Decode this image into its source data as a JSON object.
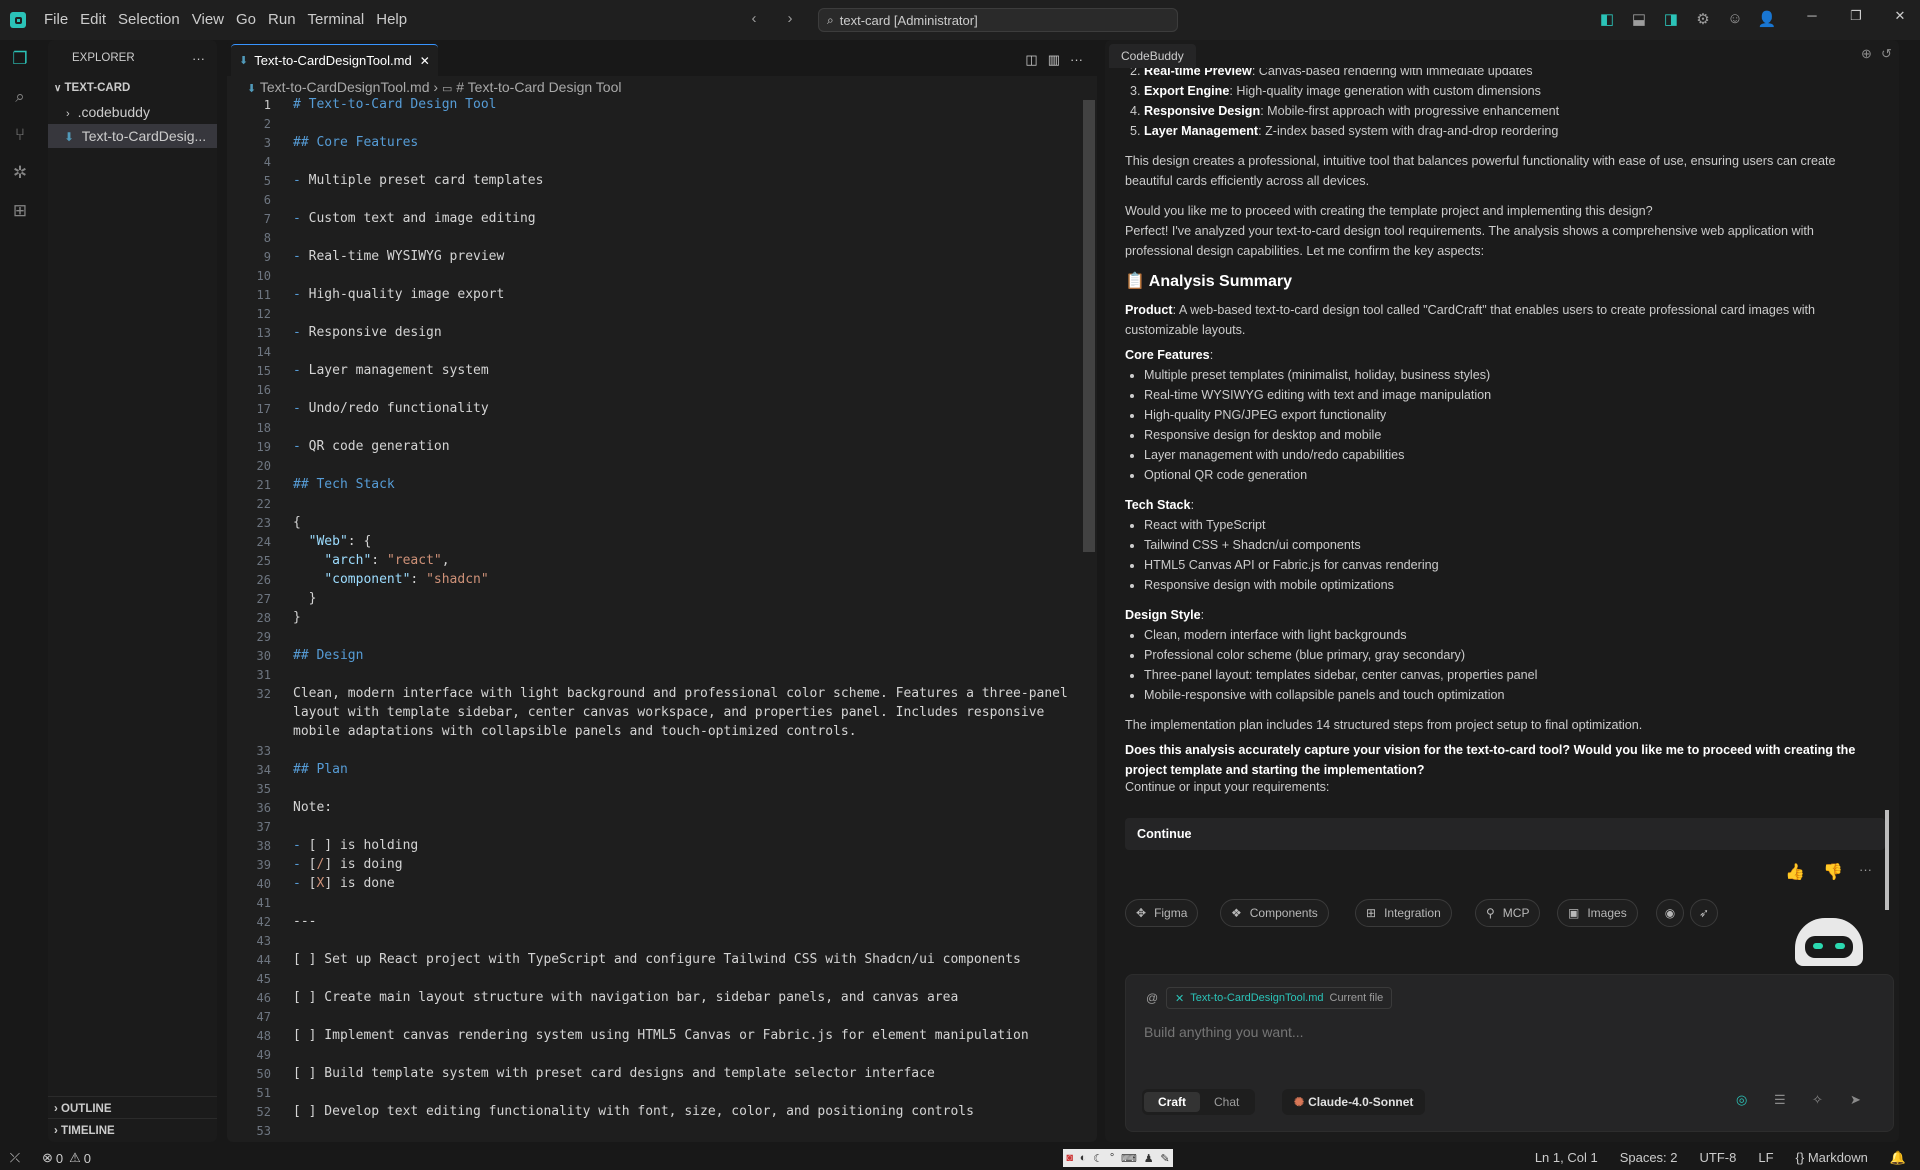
{
  "menu": [
    "File",
    "Edit",
    "Selection",
    "View",
    "Go",
    "Run",
    "Terminal",
    "Help"
  ],
  "command_center": "text-card [Administrator]",
  "explorer": {
    "title": "EXPLORER",
    "root": "TEXT-CARD",
    "items": [
      ".codebuddy",
      "Text-to-CardDesig..."
    ],
    "outline": "OUTLINE",
    "timeline": "TIMELINE"
  },
  "editor": {
    "tab": "Text-to-CardDesignTool.md",
    "breadcrumb_file": "Text-to-CardDesignTool.md",
    "breadcrumb_symbol": "# Text-to-Card Design Tool"
  },
  "code": [
    {
      "n": "1",
      "t": "# Text-to-Card Design Tool",
      "c": "h"
    },
    {
      "n": "2",
      "t": ""
    },
    {
      "n": "3",
      "t": "## Core Features",
      "c": "h"
    },
    {
      "n": "4",
      "t": ""
    },
    {
      "n": "5",
      "t": "- Multiple preset card templates"
    },
    {
      "n": "6",
      "t": ""
    },
    {
      "n": "7",
      "t": "- Custom text and image editing"
    },
    {
      "n": "8",
      "t": ""
    },
    {
      "n": "9",
      "t": "- Real-time WYSIWYG preview"
    },
    {
      "n": "10",
      "t": ""
    },
    {
      "n": "11",
      "t": "- High-quality image export"
    },
    {
      "n": "12",
      "t": ""
    },
    {
      "n": "13",
      "t": "- Responsive design"
    },
    {
      "n": "14",
      "t": ""
    },
    {
      "n": "15",
      "t": "- Layer management system"
    },
    {
      "n": "16",
      "t": ""
    },
    {
      "n": "17",
      "t": "- Undo/redo functionality"
    },
    {
      "n": "18",
      "t": ""
    },
    {
      "n": "19",
      "t": "- QR code generation"
    },
    {
      "n": "20",
      "t": ""
    },
    {
      "n": "21",
      "t": "## Tech Stack",
      "c": "h"
    },
    {
      "n": "22",
      "t": ""
    },
    {
      "n": "23",
      "t": "{"
    },
    {
      "n": "24",
      "t": "  \"Web\": {"
    },
    {
      "n": "25",
      "t": "    \"arch\": \"react\","
    },
    {
      "n": "26",
      "t": "    \"component\": \"shadcn\""
    },
    {
      "n": "27",
      "t": "  }"
    },
    {
      "n": "28",
      "t": "}"
    },
    {
      "n": "29",
      "t": ""
    },
    {
      "n": "30",
      "t": "## Design",
      "c": "h"
    },
    {
      "n": "31",
      "t": ""
    },
    {
      "n": "32",
      "t": "Clean, modern interface with light background and professional color scheme. Features a three-panel"
    },
    {
      "n": "",
      "t": "layout with template sidebar, center canvas workspace, and properties panel. Includes responsive"
    },
    {
      "n": "",
      "t": "mobile adaptations with collapsible panels and touch-optimized controls."
    },
    {
      "n": "33",
      "t": ""
    },
    {
      "n": "34",
      "t": "## Plan",
      "c": "h"
    },
    {
      "n": "35",
      "t": ""
    },
    {
      "n": "36",
      "t": "Note:"
    },
    {
      "n": "37",
      "t": ""
    },
    {
      "n": "38",
      "t": "- [ ] is holding"
    },
    {
      "n": "39",
      "t": "- [/] is doing"
    },
    {
      "n": "40",
      "t": "- [X] is done"
    },
    {
      "n": "41",
      "t": ""
    },
    {
      "n": "42",
      "t": "---"
    },
    {
      "n": "43",
      "t": ""
    },
    {
      "n": "44",
      "t": "[ ] Set up React project with TypeScript and configure Tailwind CSS with Shadcn/ui components"
    },
    {
      "n": "45",
      "t": ""
    },
    {
      "n": "46",
      "t": "[ ] Create main layout structure with navigation bar, sidebar panels, and canvas area"
    },
    {
      "n": "47",
      "t": ""
    },
    {
      "n": "48",
      "t": "[ ] Implement canvas rendering system using HTML5 Canvas or Fabric.js for element manipulation"
    },
    {
      "n": "49",
      "t": ""
    },
    {
      "n": "50",
      "t": "[ ] Build template system with preset card designs and template selector interface"
    },
    {
      "n": "51",
      "t": ""
    },
    {
      "n": "52",
      "t": "[ ] Develop text editing functionality with font, size, color, and positioning controls"
    },
    {
      "n": "53",
      "t": ""
    }
  ],
  "panel": {
    "title": "CodeBuddy",
    "top_list": [
      {
        "b": "Real-time Preview",
        "t": ": Canvas-based rendering with immediate updates"
      },
      {
        "b": "Export Engine",
        "t": ": High-quality image generation with custom dimensions"
      },
      {
        "b": "Responsive Design",
        "t": ": Mobile-first approach with progressive enhancement"
      },
      {
        "b": "Layer Management",
        "t": ": Z-index based system with drag-and-drop reordering"
      }
    ],
    "para1": "This design creates a professional, intuitive tool that balances powerful functionality with ease of use, ensuring users can create beautiful cards efficiently across all devices.",
    "para2": "Would you like me to proceed with creating the template project and implementing this design?",
    "para3": "Perfect! I've analyzed your text-to-card design tool requirements. The analysis shows a comprehensive web application with professional design capabilities. Let me confirm the key aspects:",
    "heading": "Analysis Summary",
    "product_label": "Product",
    "product_text": ": A web-based text-to-card design tool called \"CardCraft\" that enables users to create professional card images with customizable layouts.",
    "core_label": "Core Features",
    "core": [
      "Multiple preset templates (minimalist, holiday, business styles)",
      "Real-time WYSIWYG editing with text and image manipulation",
      "High-quality PNG/JPEG export functionality",
      "Responsive design for desktop and mobile",
      "Layer management with undo/redo capabilities",
      "Optional QR code generation"
    ],
    "tech_label": "Tech Stack",
    "tech": [
      "React with TypeScript",
      "Tailwind CSS + Shadcn/ui components",
      "HTML5 Canvas API or Fabric.js for canvas rendering",
      "Responsive design with mobile optimizations"
    ],
    "style_label": "Design Style",
    "style": [
      "Clean, modern interface with light backgrounds",
      "Professional color scheme (blue primary, gray secondary)",
      "Three-panel layout: templates sidebar, center canvas, properties panel",
      "Mobile-responsive with collapsible panels and touch optimization"
    ],
    "plan_text": "The implementation plan includes 14 structured steps from project setup to final optimization.",
    "question": "Does this analysis accurately capture your vision for the text-to-card tool? Would you like me to proceed with creating the project template and starting the implementation?",
    "continue_prompt": "Continue or input your requirements:",
    "continue_btn": "Continue",
    "pills": [
      "Figma",
      "Components",
      "Integration",
      "MCP",
      "Images"
    ],
    "context_file": "Text-to-CardDesignTool.md",
    "context_tag": "Current file",
    "placeholder": "Build anything you want...",
    "mode_craft": "Craft",
    "mode_chat": "Chat",
    "model": "Claude-4.0-Sonnet"
  },
  "status": {
    "errors": "0",
    "warnings": "0",
    "position": "Ln 1, Col 1",
    "spaces": "Spaces: 2",
    "encoding": "UTF-8",
    "eol": "LF",
    "language": "Markdown"
  },
  "colors": {
    "accent": "#3794ff",
    "heading": "#569cd6",
    "bg": "#1e1e1e"
  }
}
